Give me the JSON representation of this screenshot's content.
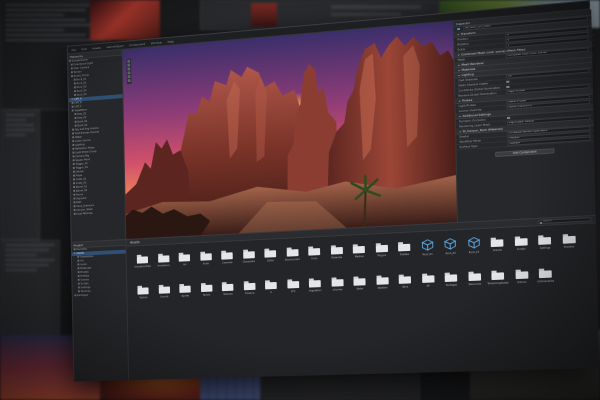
{
  "menubar": {
    "items": [
      "File",
      "Edit",
      "Assets",
      "GameObject",
      "Component",
      "Window",
      "Help"
    ]
  },
  "hierarchy": {
    "tab_label": "Hierarchy",
    "items": [
      "SampleScene",
      "Directional Light",
      "Main Camera",
      "Terrain",
      "Rocks_Group",
      "Rock_01",
      "Rock_02",
      "Rock_03",
      "Rock_04",
      "Rock_05",
      "Cliff_A",
      "Cliff_B",
      "Cliff_C",
      "Vegetation",
      "Tree_01",
      "Tree_02",
      "Bush_01",
      "Bush_02",
      "Sky and Fog Volume",
      "Post Process Volume",
      "Water",
      "Audio Source",
      "Lighting",
      "Reflection Probe",
      "Light Probe Group",
      "Camera Rig",
      "Spawn Point",
      "Trigger_01",
      "Trigger_02",
      "Decals",
      "Props",
      "Crate_01",
      "Crate_02",
      "Barrel_01",
      "Barrel_02",
      "Fence",
      "Signpost",
      "Path",
      "Cave_Entrance",
      "Canyon_Mesh",
      "Dust Particles"
    ]
  },
  "scene": {
    "toolbar_icons": [
      "hand-tool-icon",
      "move-tool-icon",
      "rotate-tool-icon",
      "scale-tool-icon",
      "rect-tool-icon",
      "transform-tool-icon"
    ]
  },
  "inspector": {
    "tab_label": "Inspector",
    "object_name": "SM_Rock_Cliff_Mesh",
    "rows": [
      {
        "type": "section",
        "label": "Transform"
      },
      {
        "type": "field",
        "label": "Position",
        "value": "0"
      },
      {
        "type": "field",
        "label": "Rotation",
        "value": "0"
      },
      {
        "type": "field",
        "label": "Scale",
        "value": "1"
      },
      {
        "type": "section",
        "label": "Combined Mesh (root: scene) (Mesh Filter)"
      },
      {
        "type": "field",
        "label": "Mesh",
        "value": "Combined Mesh (root: scene)"
      },
      {
        "type": "section",
        "label": "Mesh Renderer"
      },
      {
        "type": "section",
        "label": "Materials"
      },
      {
        "type": "section",
        "label": "Lighting"
      },
      {
        "type": "field",
        "label": "Cast Shadows",
        "value": "On"
      },
      {
        "type": "field",
        "label": "Static Shadow Caster",
        "value": ""
      },
      {
        "type": "field",
        "label": "Contribute Global Illumination",
        "value": ""
      },
      {
        "type": "field",
        "label": "Receive Global Illumination",
        "value": "Light Probes"
      },
      {
        "type": "section",
        "label": "Probes"
      },
      {
        "type": "field",
        "label": "Light Probes",
        "value": "Blend Probes"
      },
      {
        "type": "field",
        "label": "Anchor Override",
        "value": "None (Transform)"
      },
      {
        "type": "section",
        "label": "Additional Settings"
      },
      {
        "type": "field",
        "label": "Dynamic Occlusion",
        "value": ""
      },
      {
        "type": "field",
        "label": "Rendering Layer Mask",
        "value": "Light Layer default"
      },
      {
        "type": "section",
        "label": "M_Canyon_Rock (Material)"
      },
      {
        "type": "field",
        "label": "Shader",
        "value": "Universal Render Pipeline/Lit"
      },
      {
        "type": "field",
        "label": "Workflow Mode",
        "value": "Metallic"
      },
      {
        "type": "field",
        "label": "Surface Type",
        "value": "Opaque"
      }
    ],
    "add_component_label": "Add Component"
  },
  "project": {
    "tab_label": "Project",
    "breadcrumb": "Assets",
    "search_placeholder": "Search",
    "tree_items": [
      "Favorites",
      "Assets",
      "Animations",
      "Art",
      "Audio",
      "Materials",
      "Models",
      "Prefabs",
      "Scenes",
      "Scripts",
      "Settings",
      "Textures",
      "Packages"
    ],
    "assets": [
      {
        "label": "AnimationClips",
        "kind": "folder"
      },
      {
        "label": "Animations",
        "kind": "folder"
      },
      {
        "label": "Art",
        "kind": "folder"
      },
      {
        "label": "Audio",
        "kind": "folder"
      },
      {
        "label": "Cameras",
        "kind": "folder"
      },
      {
        "label": "Characters",
        "kind": "folder"
      },
      {
        "label": "Editor",
        "kind": "folder"
      },
      {
        "label": "Environment",
        "kind": "folder"
      },
      {
        "label": "Fonts",
        "kind": "folder"
      },
      {
        "label": "Materials",
        "kind": "folder"
      },
      {
        "label": "Meshes",
        "kind": "folder"
      },
      {
        "label": "Plugins",
        "kind": "folder"
      },
      {
        "label": "Prefabs",
        "kind": "folder"
      },
      {
        "label": "Rock_01",
        "kind": "mesh"
      },
      {
        "label": "Rock_02",
        "kind": "mesh"
      },
      {
        "label": "Rock_03",
        "kind": "mesh"
      },
      {
        "label": "Scenes",
        "kind": "folder"
      },
      {
        "label": "Scripts",
        "kind": "folder"
      },
      {
        "label": "Settings",
        "kind": "folder"
      },
      {
        "label": "Shaders",
        "kind": "folder"
      },
      {
        "label": "Skybox",
        "kind": "folder"
      },
      {
        "label": "Sounds",
        "kind": "folder"
      },
      {
        "label": "Sprites",
        "kind": "folder"
      },
      {
        "label": "Terrain",
        "kind": "folder"
      },
      {
        "label": "Textures",
        "kind": "folder"
      },
      {
        "label": "Timeline",
        "kind": "folder"
      },
      {
        "label": "UI",
        "kind": "folder"
      },
      {
        "label": "VFX",
        "kind": "folder"
      },
      {
        "label": "Vegetation",
        "kind": "folder"
      },
      {
        "label": "Volumes",
        "kind": "folder"
      },
      {
        "label": "Water",
        "kind": "folder"
      },
      {
        "label": "Weather",
        "kind": "folder"
      },
      {
        "label": "Wind",
        "kind": "folder"
      },
      {
        "label": "XR",
        "kind": "folder"
      },
      {
        "label": "Packages",
        "kind": "folder"
      },
      {
        "label": "Resources",
        "kind": "folder"
      },
      {
        "label": "StreamingAssets",
        "kind": "folder"
      },
      {
        "label": "Gizmos",
        "kind": "folder"
      },
      {
        "label": "Addressables",
        "kind": "folder"
      }
    ]
  },
  "colors": {
    "accent": "#4a8fd6",
    "selection": "#2f4f75",
    "mesh_cube": "#5aa8e0",
    "sky_top": "#3b2f6b",
    "sky_mid": "#d0506a",
    "sunset": "#f5a35a",
    "rock": "#8a3a2a"
  }
}
